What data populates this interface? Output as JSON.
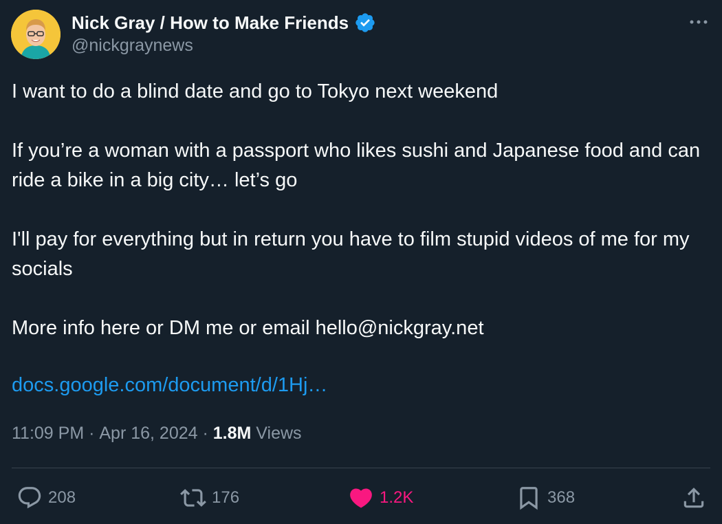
{
  "author": {
    "display_name": "Nick Gray / How to Make Friends",
    "handle": "@nickgraynews",
    "verified": true
  },
  "tweet": {
    "paragraphs": [
      "I want to do a blind date and go to Tokyo next weekend",
      "If you’re a woman with a passport who likes sushi and Japanese food and can ride a bike in a big city… let’s go",
      "I'll pay for everything but in return you have to film stupid videos of me for my socials",
      "More info here or DM me or email hello@nickgray.net"
    ],
    "link_text": "docs.google.com/document/d/1Hj…"
  },
  "meta": {
    "time": "11:09 PM",
    "separator1": " · ",
    "date": "Apr 16, 2024",
    "separator2": " · ",
    "views_count": "1.8M",
    "views_label": " Views"
  },
  "actions": {
    "replies": "208",
    "reposts": "176",
    "likes": "1.2K",
    "bookmarks": "368"
  },
  "colors": {
    "background": "#15202b",
    "text": "#f7f9f9",
    "secondary_text": "#8b98a5",
    "link": "#1d9bf0",
    "like": "#f91880",
    "verified_badge": "#1d9bf0",
    "avatar_bg": "#f5c53a"
  },
  "icons": {
    "more": "ellipsis-icon",
    "reply": "reply-icon",
    "repost": "repost-icon",
    "like": "heart-icon",
    "bookmark": "bookmark-icon",
    "share": "share-icon",
    "verified": "verified-badge-icon"
  }
}
